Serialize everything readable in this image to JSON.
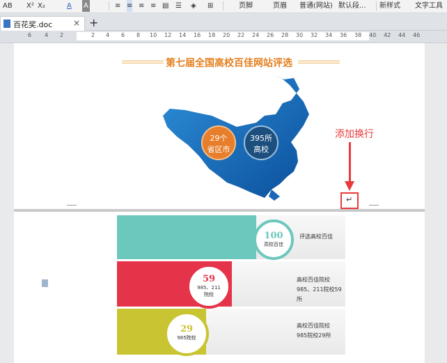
{
  "toolbar": {
    "items": [
      "AB",
      "X²",
      "X₂",
      "A",
      "A"
    ],
    "styles": [
      "页脚",
      "页眉",
      "普通(网站)",
      "默认段..."
    ],
    "new_style": "新样式",
    "text_tools": "文字工具"
  },
  "tabs": {
    "doc_title": "百花奖.doc",
    "close": "×",
    "new": "+"
  },
  "ruler": {
    "ticks": [
      "6",
      "4",
      "2",
      "2",
      "4",
      "6",
      "8",
      "10",
      "12",
      "14",
      "16",
      "18",
      "20",
      "22",
      "24",
      "26",
      "28",
      "30",
      "32",
      "34",
      "36",
      "38",
      "40",
      "42",
      "44",
      "46"
    ]
  },
  "page1": {
    "title": "第七届全国高校百佳网站评选",
    "circle1_top": "29个",
    "circle1_bottom": "省区市",
    "circle2_top": "395所",
    "circle2_bottom": "高校",
    "annotation": "添加换行",
    "paragraph_mark": "↵"
  },
  "page2": {
    "bar1": {
      "num": "100",
      "sub": "高校百佳",
      "text": "评选高校百佳",
      "color": "#6cc7bd"
    },
    "bar2": {
      "num": "59",
      "sub1": "985、211",
      "sub2": "院校",
      "text1": "高校百佳院校",
      "text2": "985、211院校59所",
      "color": "#e5334a"
    },
    "bar3": {
      "num": "29",
      "sub": "985院校",
      "text1": "高校百佳院校",
      "text2": "985院校29所",
      "color": "#c9c532"
    }
  },
  "colors": {
    "accent": "#e83a3a",
    "title": "#e37f1e"
  }
}
